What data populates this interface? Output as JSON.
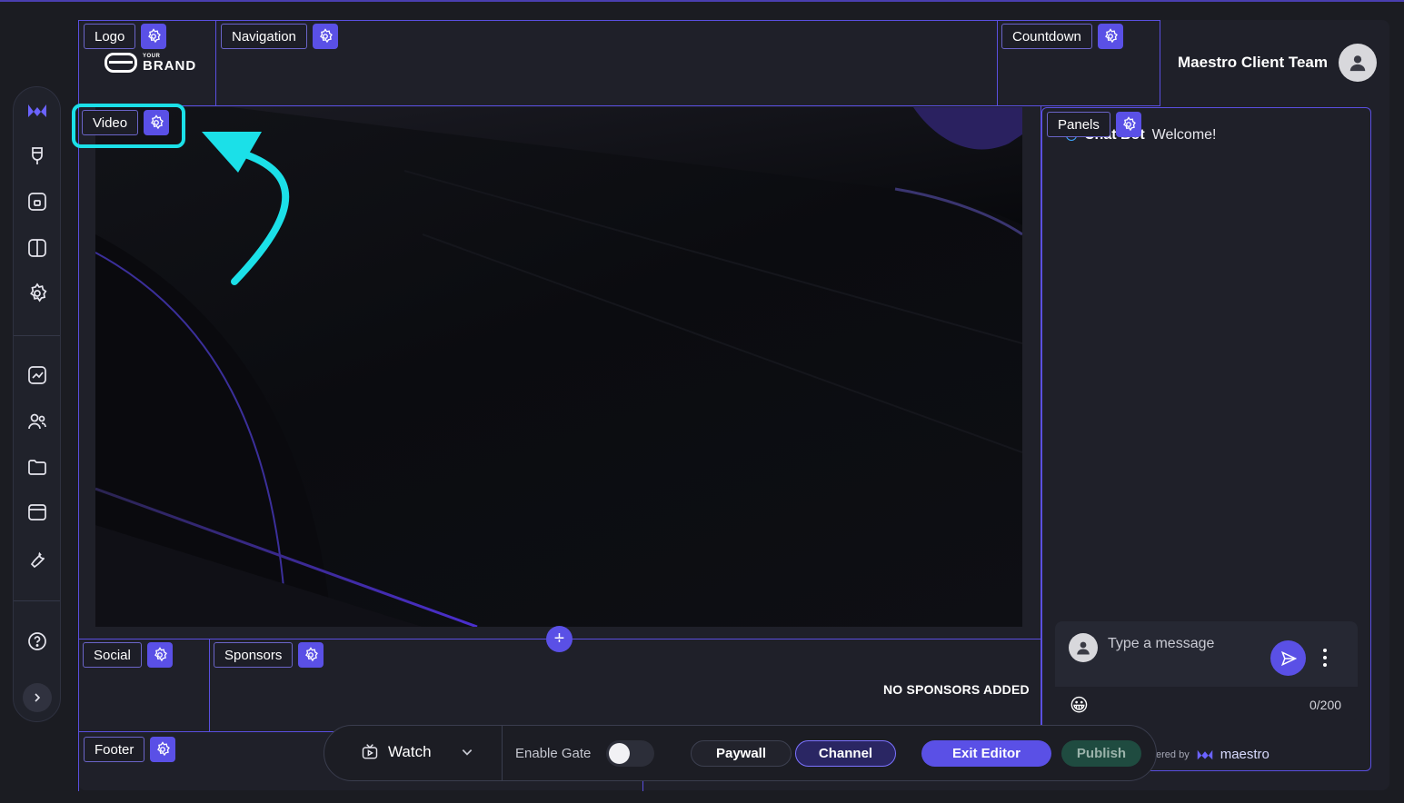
{
  "regions": {
    "logo": "Logo",
    "navigation": "Navigation",
    "countdown": "Countdown",
    "video": "Video",
    "panels": "Panels",
    "social": "Social",
    "sponsors": "Sponsors",
    "footer": "Footer"
  },
  "brand": {
    "small": "YOUR",
    "big": "BRAND"
  },
  "user": {
    "name": "Maestro Client Team"
  },
  "sponsors": {
    "empty_text": "NO SPONSORS ADDED"
  },
  "chat": {
    "bot_name": "Chat Bot",
    "welcome": "Welcome!",
    "placeholder": "Type a message",
    "emoji": "😀",
    "count": "0/200",
    "powered_by": "ered by",
    "powered_brand": "maestro"
  },
  "toolbar": {
    "watch": "Watch",
    "enable_gate": "Enable Gate",
    "gate_enabled": false,
    "paywall": "Paywall",
    "channel": "Channel",
    "exit_editor": "Exit Editor",
    "publish": "Publish"
  },
  "colors": {
    "accent": "#5a50e6",
    "highlight": "#1be0e8",
    "background": "#1b1c22"
  },
  "rail_icons": [
    "maestro-logo-icon",
    "brush-icon",
    "layout-icon",
    "sidebar-icon",
    "gear-icon",
    "analytics-icon",
    "users-icon",
    "folder-icon",
    "card-icon",
    "wrench-icon",
    "help-icon",
    "chevron-right-icon"
  ]
}
